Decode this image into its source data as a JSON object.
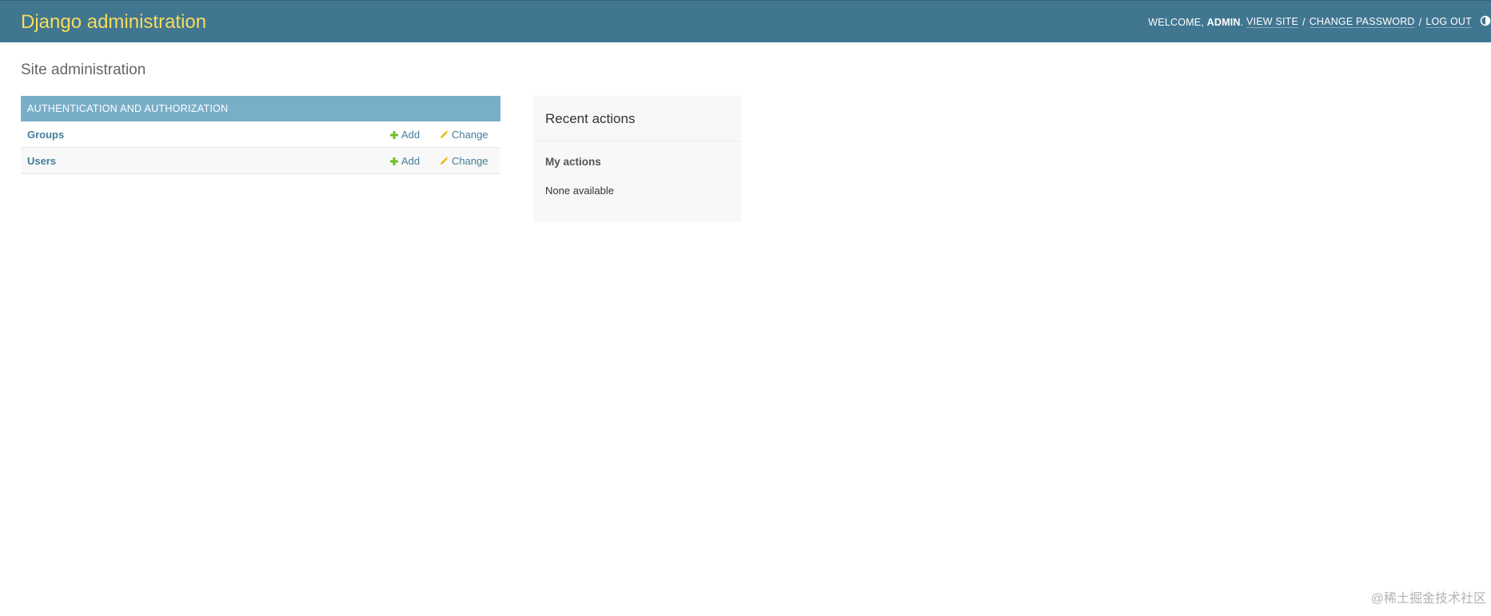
{
  "header": {
    "branding": "Django administration",
    "welcome_text": "WELCOME,",
    "username": "ADMIN",
    "username_suffix": ".",
    "view_site": "VIEW SITE",
    "change_password": "CHANGE PASSWORD",
    "log_out": "LOG OUT",
    "separator": "/",
    "theme_toggle_icon": "half-circle-icon"
  },
  "page_title": "Site administration",
  "apps": [
    {
      "caption": "AUTHENTICATION AND AUTHORIZATION",
      "models": [
        {
          "name": "Groups",
          "add_label": "Add",
          "change_label": "Change"
        },
        {
          "name": "Users",
          "add_label": "Add",
          "change_label": "Change"
        }
      ]
    }
  ],
  "recent_actions": {
    "title": "Recent actions",
    "my_actions_title": "My actions",
    "empty_text": "None available"
  },
  "watermark": "@稀土掘金技术社区",
  "colors": {
    "header_bg": "#417690",
    "branding": "#f5dd5d",
    "module_caption_bg": "#79aec8",
    "link": "#447e9b",
    "add_icon": "#70bf2b",
    "change_icon": "#efb80b"
  }
}
